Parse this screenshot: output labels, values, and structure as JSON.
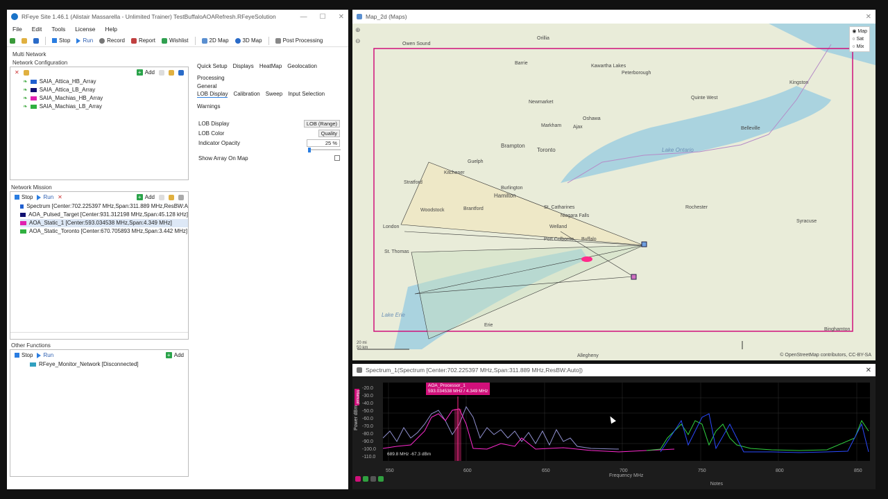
{
  "app": {
    "title": "RFeye Site 1.46.1 (Alistair Massarella - Unlimited Trainer) TestBuffaloAOARefresh.RFeyeSolution",
    "menu": [
      "File",
      "Edit",
      "Tools",
      "License",
      "Help"
    ],
    "toolbar": {
      "stop": "Stop",
      "run": "Run",
      "record": "Record",
      "report": "Report",
      "wishlist": "Wishlist",
      "map2d": "2D Map",
      "map3d": "3D Map",
      "post": "Post Processing"
    }
  },
  "network_config": {
    "header": "Multi Network",
    "title": "Network Configuration",
    "add": "Add",
    "arrays": [
      {
        "name": "SAIA_Attica_HB_Array",
        "color": "#1f5fd0"
      },
      {
        "name": "SAIA_Attica_LB_Array",
        "color": "#101070"
      },
      {
        "name": "SAIA_Machias_HB_Array",
        "color": "#e020b0"
      },
      {
        "name": "SAIA_Machias_LB_Array",
        "color": "#30b040"
      }
    ]
  },
  "settings": {
    "tabs": [
      "Quick Setup",
      "Displays",
      "HeatMap",
      "Geolocation",
      "Processing"
    ],
    "tab_general": "General",
    "subtabs": [
      "LOB Display",
      "Calibration",
      "Sweep",
      "Input Selection",
      "Warnings"
    ],
    "rows": [
      {
        "label": "LOB Display",
        "value": "LOB (Range)"
      },
      {
        "label": "LOB Color",
        "value": "Quality"
      },
      {
        "label": "Indicator Opacity",
        "value": "25 %"
      },
      {
        "label": "Show Array On Map",
        "value": ""
      }
    ]
  },
  "mission": {
    "title": "Network Mission",
    "stop": "Stop",
    "run": "Run",
    "add": "Add",
    "items": [
      {
        "text": "Spectrum [Center:702.225397 MHz,Span:311.889 MHz,ResBW:A",
        "color": "#1f5fd0"
      },
      {
        "text": "AOA_Pulsed_Target [Center:931.312198 MHz,Span:45.128 kHz]",
        "color": "#101070"
      },
      {
        "text": "AOA_Static_1 [Center:593.034538 MHz,Span:4.349 MHz]",
        "color": "#e020b0"
      },
      {
        "text": "AOA_Static_Toronto [Center:670.705893 MHz,Span:3.442 MHz]",
        "color": "#30b040"
      }
    ]
  },
  "other": {
    "title": "Other Functions",
    "stop": "Stop",
    "run": "Run",
    "add": "Add",
    "item": "RFeye_Monitor_Network [Disconnected]"
  },
  "map": {
    "title": "Map_2d (Maps)",
    "layers": [
      "Map",
      "Sat",
      "Mix"
    ],
    "attribution": "© OpenStreetMap contributors, CC-BY-SA",
    "scale": [
      "20 mi",
      "50 km"
    ],
    "cities": [
      {
        "name": "Owen Sound"
      },
      {
        "name": "Orillia"
      },
      {
        "name": "Barrie"
      },
      {
        "name": "Kawartha Lakes"
      },
      {
        "name": "Peterborough"
      },
      {
        "name": "Kingston"
      },
      {
        "name": "Quinte West"
      },
      {
        "name": "Newmarket"
      },
      {
        "name": "Oshawa"
      },
      {
        "name": "Markham"
      },
      {
        "name": "Ajax"
      },
      {
        "name": "Brampton"
      },
      {
        "name": "Toronto"
      },
      {
        "name": "Belleville"
      },
      {
        "name": "Guelph"
      },
      {
        "name": "Kitchener"
      },
      {
        "name": "Stratford"
      },
      {
        "name": "Burlington"
      },
      {
        "name": "Hamilton"
      },
      {
        "name": "Brantford"
      },
      {
        "name": "Woodstock"
      },
      {
        "name": "London"
      },
      {
        "name": "St. Catharines"
      },
      {
        "name": "Niagara Falls"
      },
      {
        "name": "Welland"
      },
      {
        "name": "Port Colborne"
      },
      {
        "name": "Buffalo"
      },
      {
        "name": "Rochester"
      },
      {
        "name": "Syracuse"
      },
      {
        "name": "St. Thomas"
      },
      {
        "name": "Erie"
      },
      {
        "name": "Allegheny"
      },
      {
        "name": "Binghamton"
      }
    ],
    "water": [
      "Lake Ontario",
      "Lake Erie"
    ]
  },
  "spectrum": {
    "title": "Spectrum_1(Spectrum [Center:702.225397 MHz,Span:311.889 MHz,ResBW:Auto])",
    "ylabel": "Power dBm",
    "mode": "Manual",
    "yticks": [
      "-20.0",
      "-30.0",
      "-40.0",
      "-50.0",
      "-60.0",
      "-70.0",
      "-80.0",
      "-90.0",
      "-100.0",
      "-110.0"
    ],
    "xticks": [
      "550",
      "600",
      "650",
      "700",
      "750",
      "800",
      "850"
    ],
    "xlabel": "Frequency MHz",
    "marker_name": "AOA_Processor_1",
    "marker_value": "593.034538 MHz / 4.349 MHz",
    "cursor_readout": "689.8 MHz -67.3 dBm",
    "status": "Notes"
  }
}
